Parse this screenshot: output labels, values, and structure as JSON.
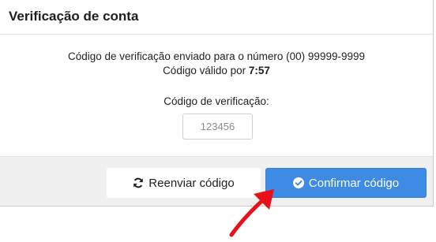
{
  "modal": {
    "title": "Verificação de conta",
    "message_line1": "Código de verificação enviado para o número (00) 99999-9999",
    "message_line2_prefix": "Código válido por ",
    "timer": "7:57",
    "field_label": "Código de verificação:",
    "code_placeholder": "123456"
  },
  "buttons": {
    "resend_label": "Reenviar código",
    "resend_icon": "refresh-icon",
    "confirm_label": "Confirmar código",
    "confirm_icon": "check-circle-icon"
  },
  "colors": {
    "primary": "#3d8be4",
    "annotation_arrow": "#e8101a",
    "footer_bg": "#f0f0f0"
  },
  "annotation": {
    "icon": "red-arrow-pointing-to-confirm-button"
  }
}
